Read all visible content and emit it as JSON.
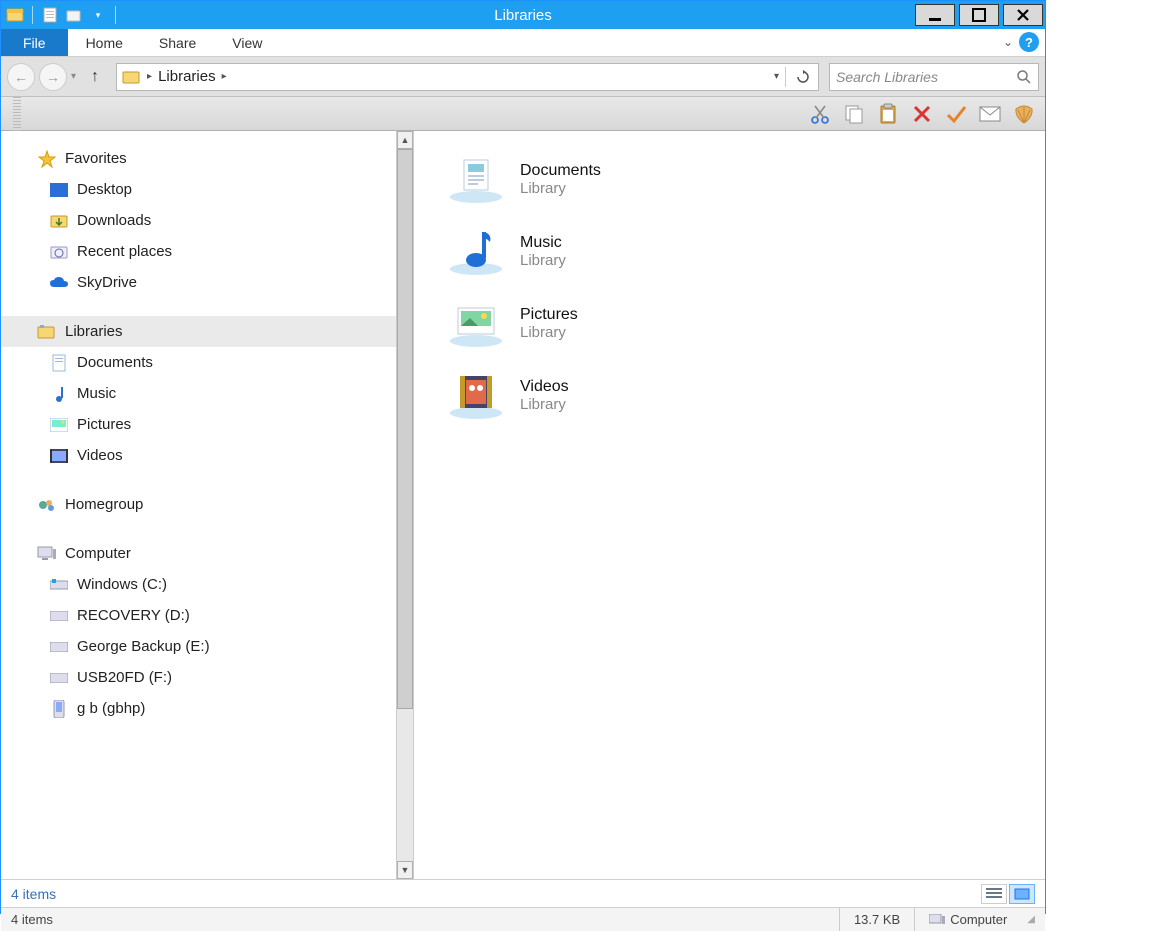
{
  "window": {
    "title": "Libraries"
  },
  "ribbon": {
    "file": "File",
    "tabs": [
      "Home",
      "Share",
      "View"
    ]
  },
  "address": {
    "location": "Libraries",
    "search_placeholder": "Search Libraries"
  },
  "nav": {
    "favorites": {
      "label": "Favorites",
      "items": [
        "Desktop",
        "Downloads",
        "Recent places",
        "SkyDrive"
      ]
    },
    "libraries": {
      "label": "Libraries",
      "items": [
        "Documents",
        "Music",
        "Pictures",
        "Videos"
      ]
    },
    "homegroup": {
      "label": "Homegroup"
    },
    "computer": {
      "label": "Computer",
      "items": [
        "Windows (C:)",
        "RECOVERY (D:)",
        "George Backup (E:)",
        "USB20FD (F:)",
        "g b (gbhp)"
      ]
    }
  },
  "content": {
    "items": [
      {
        "name": "Documents",
        "type": "Library"
      },
      {
        "name": "Music",
        "type": "Library"
      },
      {
        "name": "Pictures",
        "type": "Library"
      },
      {
        "name": "Videos",
        "type": "Library"
      }
    ]
  },
  "status": {
    "count_label": "4 items",
    "count_label2": "4 items",
    "size": "13.7 KB",
    "location": "Computer"
  }
}
